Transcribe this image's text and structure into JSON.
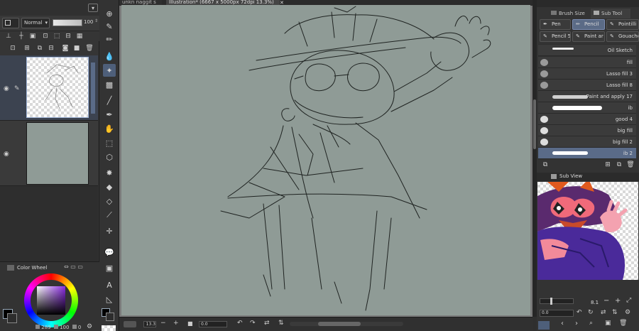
{
  "blend_mode": "Normal",
  "opacity_value": "100",
  "tabs": [
    "unkn naggit s",
    "Illustration* (6667 x 5000px 72dpi 13.3%)"
  ],
  "color_wheel": {
    "title": "Color Wheel",
    "h_value": "289",
    "s_value": "100",
    "v_value": "0"
  },
  "zoom_value": "13.3",
  "rotate_value": "0.0",
  "right_panel": {
    "tabs": [
      "Brush Size",
      "Sub Tool"
    ],
    "presets": [
      "Pen",
      "Pencil",
      "Pointilli",
      "Pencil 5",
      "Paint ar",
      "Gouache"
    ],
    "brushes": [
      "Oil Sketch",
      "fill",
      "Lasso fill 3",
      "Lasso fill 8",
      "Paint and apply 17",
      "ib",
      "good 4",
      "big fill",
      "big fill 2",
      "ib 2"
    ],
    "subview_title": "Sub View",
    "nav_zoom": "8.1",
    "nav_rotate": "0.0"
  },
  "colors": {
    "accent": "#4e5f7a",
    "canvas": "#8f9b96",
    "panel": "#333333",
    "active_row": "#5a6b88"
  }
}
